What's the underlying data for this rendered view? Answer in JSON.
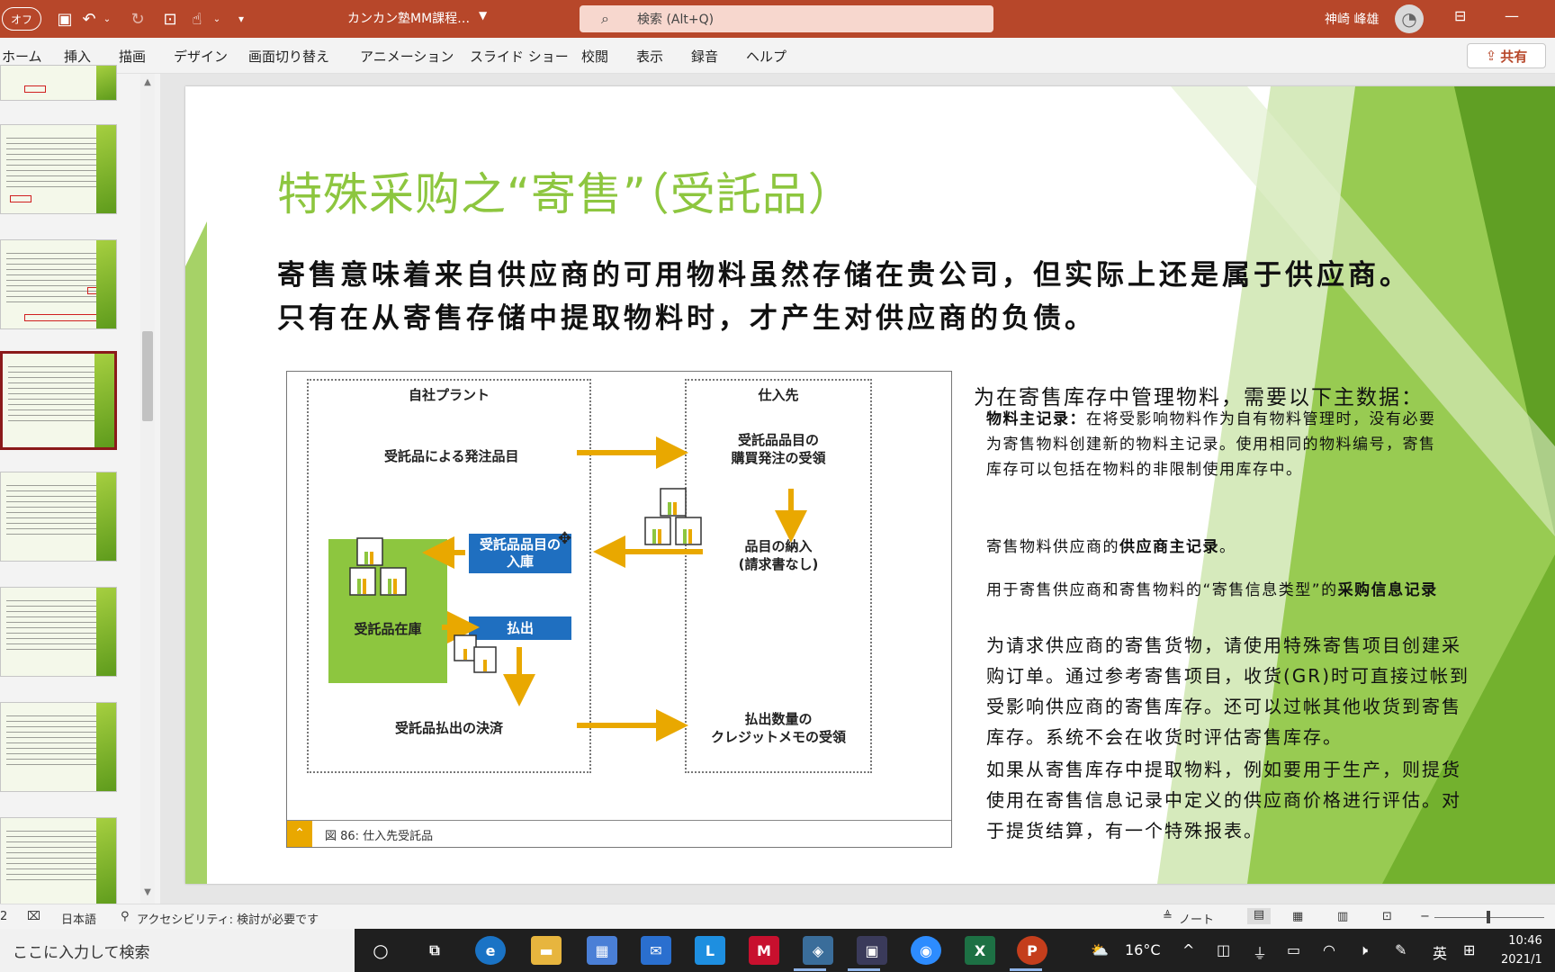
{
  "titlebar": {
    "autosave_label": "オフ",
    "doc_title": "カンカン塾MM課程…",
    "search_placeholder": "検索 (Alt+Q)",
    "user_name": "神崎 峰雄"
  },
  "ribbon": {
    "tabs": [
      "ホーム",
      "挿入",
      "描画",
      "デザイン",
      "画面切り替え",
      "アニメーション",
      "スライド ショー",
      "校閲",
      "表示",
      "録音",
      "ヘルプ"
    ],
    "share_label": "共有"
  },
  "slide": {
    "title": "特殊采购之“寄售”（受託品）",
    "intro_line1": "寄售意味着来自供应商的可用物料虽然存储在贵公司，但实际上还是属于供应商。",
    "intro_line2": "只有在从寄售存储中提取物料时，才产生对供应商的负债。",
    "figure": {
      "left_header": "自社プラント",
      "right_header": "仕入先",
      "order_item": "受託品による発注品目",
      "po_receipt_line1": "受託品品目の",
      "po_receipt_line2": "購買発注の受領",
      "delivery_line1": "品目の納入",
      "delivery_line2": "(請求書なし)",
      "receipt_box_line1": "受託品品目の",
      "receipt_box_line2": "入庫",
      "stock_label": "受託品在庫",
      "issue_box": "払出",
      "settlement": "受託品払出の決済",
      "credit_line1": "払出数量の",
      "credit_line2": "クレジットメモの受領",
      "caption": "図 86: 仕入先受託品"
    },
    "right": {
      "heading": "为在寄售库存中管理物料，需要以下主数据：",
      "p1_bold": "物料主记录：",
      "p1_line1_rest": "在将受影响物料作为自有物料管理时，没有必要",
      "p1_line2": "为寄售物料创建新的物料主记录。使用相同的物料编号，寄售",
      "p1_line3": "库存可以包括在物料的非限制使用库存中。",
      "p2_prefix": "寄售物料供应商的",
      "p2_bold": "供应商主记录",
      "p2_suffix": "。",
      "p3_prefix": "用于寄售供应商和寄售物料的“寄售信息类型”的",
      "p3_bold": "采购信息记录",
      "p4_line1": "为请求供应商的寄售货物，请使用特殊寄售项目创建采",
      "p4_line2": "购订单。通过参考寄售项目，收货(GR)时可直接过帐到",
      "p4_line3": "受影响供应商的寄售库存。还可以过帐其他收货到寄售",
      "p4_line4": "库存。系统不会在收货时评估寄售库存。",
      "p5_line1": "如果从寄售库存中提取物料，例如要用于生产，则提货",
      "p5_line2": "使用在寄售信息记录中定义的供应商价格进行评估。对",
      "p5_line3": "于提货结算，有一个特殊报表。"
    }
  },
  "statusbar": {
    "slide_num": "2",
    "language": "日本語",
    "accessibility": "アクセシビリティ: 検討が必要です",
    "notes": "ノート"
  },
  "taskbar": {
    "search_placeholder": "ここに入力して検索",
    "weather": "16°C",
    "ime_lang": "英",
    "time": "10:46",
    "date": "2021/1"
  },
  "colors": {
    "accent": "#b7472a",
    "slide_green": "#8dc63f",
    "diagram_blue": "#1f6fc0",
    "arrow_orange": "#e9a800"
  }
}
